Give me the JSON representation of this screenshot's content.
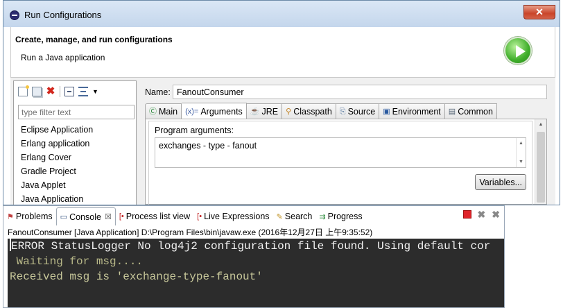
{
  "dialog": {
    "title": "Run Configurations",
    "close_label": "✕",
    "header_title": "Create, manage, and run configurations",
    "header_subtitle": "Run a Java application"
  },
  "left_panel": {
    "filter_placeholder": "type filter text",
    "items": [
      {
        "label": "Eclipse Application"
      },
      {
        "label": "Erlang application"
      },
      {
        "label": "Erlang Cover"
      },
      {
        "label": "Gradle Project"
      },
      {
        "label": "Java Applet"
      },
      {
        "label": "Java Application"
      }
    ]
  },
  "config": {
    "name_label": "Name:",
    "name_value": "FanoutConsumer",
    "tabs": [
      {
        "label": "Main",
        "icon": "main-icon"
      },
      {
        "label": "Arguments",
        "icon": "arguments-icon",
        "active": true
      },
      {
        "label": "JRE",
        "icon": "jre-icon"
      },
      {
        "label": "Classpath",
        "icon": "classpath-icon"
      },
      {
        "label": "Source",
        "icon": "source-icon"
      },
      {
        "label": "Environment",
        "icon": "environment-icon"
      },
      {
        "label": "Common",
        "icon": "common-icon"
      }
    ],
    "program_args_label": "Program arguments:",
    "program_args_value": "exchanges - type - fanout",
    "variables_button": "Variables..."
  },
  "console_view": {
    "tabs": [
      {
        "label": "Problems",
        "icon": "problems-icon"
      },
      {
        "label": "Console",
        "icon": "console-icon",
        "active": true
      },
      {
        "label": "Process list view",
        "icon": "process-list-icon"
      },
      {
        "label": "Live Expressions",
        "icon": "live-expressions-icon"
      },
      {
        "label": "Search",
        "icon": "search-icon"
      },
      {
        "label": "Progress",
        "icon": "progress-icon"
      }
    ],
    "process_label": "FanoutConsumer [Java Application] D:\\Program Files\\bin\\javaw.exe (2016年12月27日 上午9:35:52)",
    "lines": [
      "ERROR StatusLogger No log4j2 configuration file found. Using default cor",
      " Waiting for msg....",
      "Received msg is 'exchange-type-fanout'"
    ]
  },
  "colors": {
    "titlebar": "#c4d6ec",
    "console_bg": "#2c2c2c",
    "run_icon": "#3fae2a",
    "stop_icon": "#e0242a"
  }
}
